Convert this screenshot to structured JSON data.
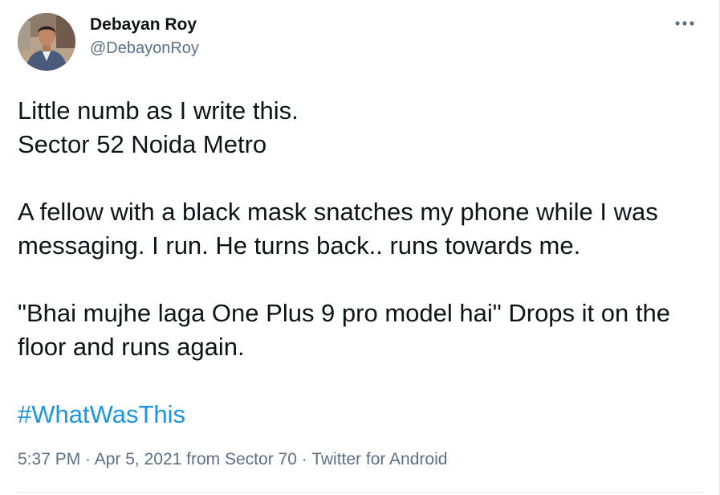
{
  "author": {
    "display_name": "Debayan Roy",
    "handle": "@DebayonRoy"
  },
  "menu": {
    "icon": "more-horizontal-icon"
  },
  "tweet": {
    "line1": "Little numb as I write this.",
    "line2": "Sector 52 Noida Metro",
    "paragraph2": "A fellow with a black mask snatches my phone while I was messaging. I run. He turns back.. runs towards me.",
    "paragraph3": "\"Bhai mujhe laga One Plus 9 pro model hai\" Drops it on the floor and runs again.",
    "hashtag": "#WhatWasThis"
  },
  "meta": {
    "time": "5:37 PM",
    "separator": " · ",
    "date": "Apr 5, 2021",
    "from_prefix": " from ",
    "location": "Sector 70",
    "client": "Twitter for Android"
  },
  "colors": {
    "text": "#0f1419",
    "secondary": "#5b7083",
    "link": "#1b95e0"
  }
}
